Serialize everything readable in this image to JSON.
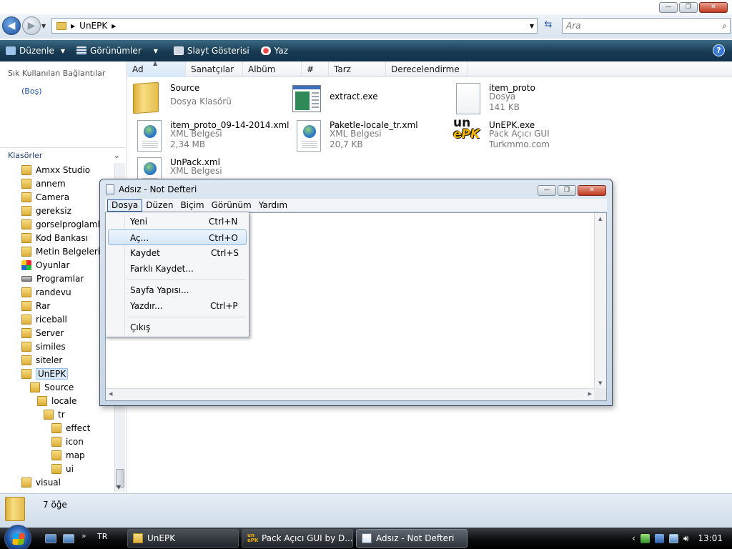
{
  "explorer": {
    "address": {
      "crumb": "UnEPK",
      "search_placeholder": "Ara"
    },
    "toolbar": {
      "organize": "Düzenle",
      "views": "Görünümler",
      "slideshow": "Slayt Gösterisi",
      "print": "Yaz"
    },
    "favorites": {
      "title": "Sık Kullanılan Bağlantılar",
      "empty": "(Boş)"
    },
    "folders_header": "Klasörler",
    "tree": [
      "Amxx Studio",
      "annem",
      "Camera",
      "gereksiz",
      "gorselproglamlar",
      "Kod Bankası",
      "Metin Belgelerim",
      "Oyunlar",
      "Programlar",
      "randevu",
      "Rar",
      "riceball",
      "Server",
      "similes",
      "siteler",
      "UnEPK",
      "Source",
      "locale",
      "tr",
      "effect",
      "icon",
      "map",
      "ui",
      "visual"
    ],
    "columns": [
      "Ad",
      "Sanatçılar",
      "Albüm",
      "#",
      "Tarz",
      "Derecelendirme"
    ],
    "files": [
      {
        "name": "Source",
        "sub1": "Dosya Klasörü",
        "sub2": ""
      },
      {
        "name": "extract.exe",
        "sub1": "",
        "sub2": ""
      },
      {
        "name": "item_proto",
        "sub1": "Dosya",
        "sub2": "141 KB"
      },
      {
        "name": "item_proto_09-14-2014.xml",
        "sub1": "XML Belgesi",
        "sub2": "2,34 MB"
      },
      {
        "name": "Paketle-locale_tr.xml",
        "sub1": "XML Belgesi",
        "sub2": "20,7 KB"
      },
      {
        "name": "UnEPK.exe",
        "sub1": "Pack Açıcı GUI",
        "sub2": "Turkmmo.com"
      },
      {
        "name": "UnPack.xml",
        "sub1": "XML Belgesi",
        "sub2": ""
      }
    ],
    "status": "7 öğe"
  },
  "notepad": {
    "title": "Adsız - Not Defteri",
    "menus": [
      "Dosya",
      "Düzen",
      "Biçim",
      "Görünüm",
      "Yardım"
    ],
    "file_menu": [
      {
        "label": "Yeni",
        "shortcut": "Ctrl+N"
      },
      {
        "label": "Aç...",
        "shortcut": "Ctrl+O"
      },
      {
        "label": "Kaydet",
        "shortcut": "Ctrl+S"
      },
      {
        "label": "Farklı Kaydet...",
        "shortcut": ""
      },
      {
        "label": "Sayfa Yapısı...",
        "shortcut": ""
      },
      {
        "label": "Yazdır...",
        "shortcut": "Ctrl+P"
      },
      {
        "label": "Çıkış",
        "shortcut": ""
      }
    ],
    "text": ""
  },
  "taskbar": {
    "lang": "TR",
    "tasks": [
      "UnEPK",
      "Pack Açıcı GUI by D...",
      "Adsız - Not Defteri"
    ],
    "logo_text": {
      "un": "un",
      "epk": "ePK"
    },
    "clock": "13:01"
  },
  "icons": {
    "back": "back-arrow-icon",
    "forward": "forward-arrow-icon",
    "search": "search-icon",
    "help": "help-icon",
    "folder": "folder-icon",
    "xml": "xml-document-icon"
  }
}
